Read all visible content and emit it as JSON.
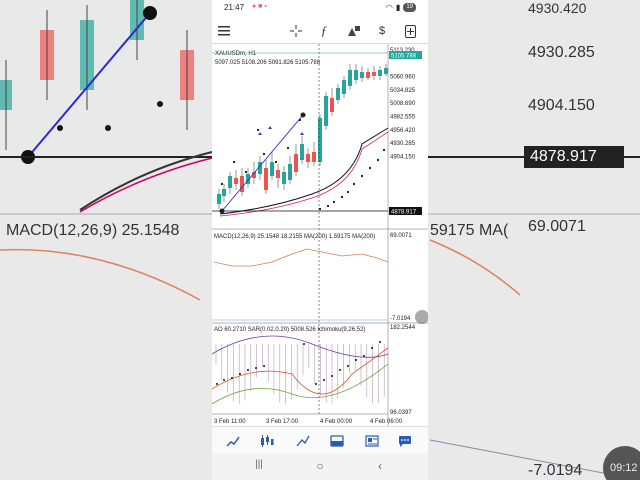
{
  "status": {
    "time": "21:47",
    "battery": "19"
  },
  "chart": {
    "symbol": "XAUUSDm, H1",
    "ohlc": "5097.025 5108.206 5091.826 5105.788",
    "price_labels": [
      "5113.230",
      "5086.895",
      "5060.960",
      "5034.825",
      "5008.690",
      "4982.555",
      "4956.420",
      "4930.285",
      "4904.150"
    ],
    "current_price": "5105.788",
    "crosshair_price": "4878.917",
    "macd_label": "MACD(12,26,9) 25.1548 18.2155 MA(200) 1.59175 MA(200)",
    "macd_high": "69.0071",
    "macd_low": "-7.0194",
    "ao_label": "AO 60.2710 SAR(0.02,0.20) 5008.526 Ichimoku(9,26,52)",
    "ao_high": "182.2544",
    "ao_low": "96.0397",
    "time_labels": [
      "3 Feb 11:00",
      "3 Feb 17:00",
      "4 Feb 00:00",
      "4 Feb 06:00"
    ]
  },
  "background": {
    "prices": [
      "4930.285",
      "4904.150",
      "4878.917",
      "69.0071",
      "-7.0194"
    ],
    "macd_label": "MACD(12,26,9) 25.1548",
    "macd_right": "59175 MA(",
    "top_price": "4930.420",
    "corner_time": "09:12"
  },
  "toolbar_icons": [
    "menu-icon",
    "crosshair-icon",
    "function-icon",
    "objects-icon",
    "symbol-change-icon",
    "add-order-icon"
  ],
  "nav_icons": [
    "quotes-icon",
    "chart-icon",
    "trade-icon",
    "history-icon",
    "news-icon",
    "messages-icon"
  ],
  "colors": {
    "bull": "#26a69a",
    "bear": "#ef5350",
    "trend": "#2b2bd6"
  }
}
